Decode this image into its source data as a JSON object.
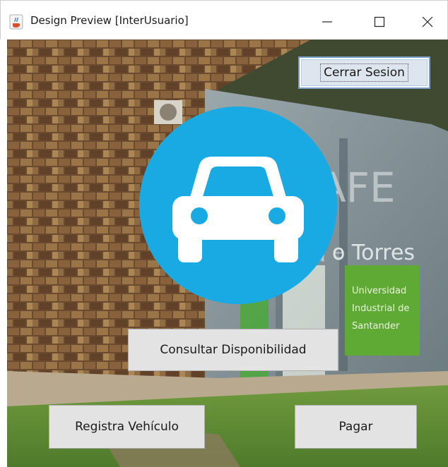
{
  "window": {
    "title": "Design Preview [InterUsuario]",
    "app_icon": "java-cup-icon",
    "controls": {
      "minimize": "minimize-icon",
      "maximize": "maximize-icon",
      "close": "close-icon"
    }
  },
  "background": {
    "sign_lines": [
      "Universidad",
      "Industrial de",
      "Santander"
    ],
    "facade_text": "o Torres"
  },
  "logo": {
    "icon": "car-icon",
    "circle_color": "#1aaae3"
  },
  "buttons": {
    "logout_label": "Cerrar Sesion",
    "check_availability_label": "Consultar Disponibilidad",
    "register_vehicle_label": "Registra Vehículo",
    "pay_label": "Pagar"
  }
}
